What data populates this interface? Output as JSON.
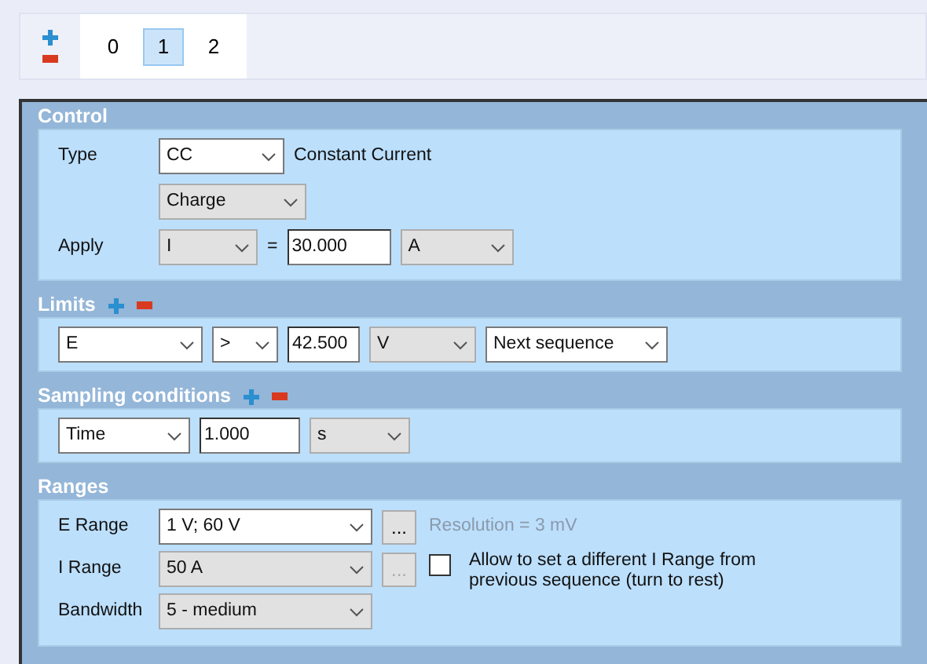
{
  "tabs": [
    {
      "label": "0",
      "selected": false
    },
    {
      "label": "1",
      "selected": true
    },
    {
      "label": "2",
      "selected": false
    }
  ],
  "sections": [
    {
      "title": "Control",
      "add_remove": false,
      "rows": [
        {
          "label": "Type",
          "items": [
            {
              "kind": "select",
              "value": "CC",
              "greyed": false
            },
            {
              "kind": "text",
              "text": "Constant Current"
            }
          ]
        },
        {
          "items": [
            {
              "kind": "select",
              "value": "Charge",
              "greyed": true
            }
          ]
        },
        {
          "label": "Apply",
          "items": [
            {
              "kind": "select",
              "value": "I",
              "greyed": true
            },
            {
              "kind": "text",
              "text": "="
            },
            {
              "kind": "input",
              "value": "30.000"
            },
            {
              "kind": "select",
              "value": "A",
              "greyed": true
            }
          ]
        }
      ]
    },
    {
      "title": "Limits",
      "add_remove": true,
      "rows": [
        {
          "items": [
            {
              "kind": "select",
              "value": "E",
              "greyed": false
            },
            {
              "kind": "select",
              "value": ">",
              "greyed": false
            },
            {
              "kind": "input",
              "value": "42.500"
            },
            {
              "kind": "select",
              "value": "V",
              "greyed": true
            },
            {
              "kind": "select",
              "value": "Next sequence",
              "greyed": false
            }
          ]
        }
      ]
    },
    {
      "title": "Sampling conditions",
      "add_remove": true,
      "rows": [
        {
          "items": [
            {
              "kind": "select",
              "value": "Time",
              "greyed": false
            },
            {
              "kind": "input",
              "value": "1.000"
            },
            {
              "kind": "select",
              "value": "s",
              "greyed": true
            }
          ]
        }
      ]
    },
    {
      "title": "Ranges",
      "add_remove": false,
      "rows": [
        {
          "label": "E Range",
          "items": [
            {
              "kind": "select",
              "value": "1 V; 60 V",
              "greyed": false
            },
            {
              "kind": "ellipsis",
              "text": "...",
              "disabled": false
            },
            {
              "kind": "note",
              "text": "Resolution = 3 mV"
            }
          ]
        },
        {
          "label": "I Range",
          "items": [
            {
              "kind": "select",
              "value": "50 A",
              "greyed": true
            },
            {
              "kind": "ellipsis",
              "text": "...",
              "disabled": true
            },
            {
              "kind": "checkbox",
              "text": "Allow to set a different I Range from previous sequence (turn to rest)",
              "checked": false
            }
          ]
        },
        {
          "label": "Bandwidth",
          "items": [
            {
              "kind": "select",
              "value": "5 - medium",
              "greyed": true
            }
          ]
        }
      ]
    }
  ]
}
